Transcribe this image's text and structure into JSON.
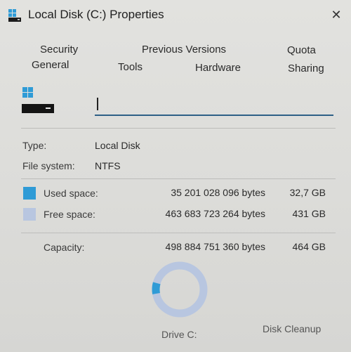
{
  "window": {
    "title": "Local Disk (C:) Properties",
    "close_glyph": "✕"
  },
  "tabs": {
    "row1": [
      "Security",
      "Previous Versions",
      "Quota"
    ],
    "row2": [
      "General",
      "Tools",
      "Hardware",
      "Sharing"
    ]
  },
  "general": {
    "name_value": "",
    "type_label": "Type:",
    "type_value": "Local Disk",
    "fs_label": "File system:",
    "fs_value": "NTFS",
    "used": {
      "label": "Used space:",
      "bytes": "35 201 028 096 bytes",
      "size": "32,7 GB"
    },
    "free": {
      "label": "Free space:",
      "bytes": "463 683 723 264 bytes",
      "size": "431 GB"
    },
    "capacity": {
      "label": "Capacity:",
      "bytes": "498 884 751 360 bytes",
      "size": "464 GB"
    },
    "drive_label": "Drive C:",
    "cleanup_label": "Disk Cleanup",
    "used_fraction": 0.0706
  },
  "colors": {
    "used": "#2f9bd6",
    "free": "#b8c6e0",
    "accent": "#2d5f86"
  },
  "icons": {
    "title": "drive-icon",
    "drive": "windows-drive-icon"
  }
}
